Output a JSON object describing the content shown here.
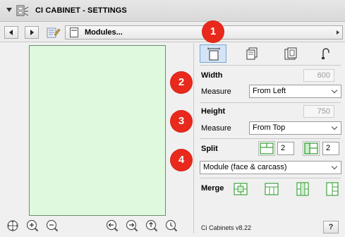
{
  "window": {
    "title": "CI CABINET - SETTINGS"
  },
  "toolbar": {
    "module_popup": "Modules..."
  },
  "width": {
    "title": "Width",
    "value": "600",
    "measure_label": "Measure",
    "measure_value": "From Left"
  },
  "height": {
    "title": "Height",
    "value": "750",
    "measure_label": "Measure",
    "measure_value": "From Top"
  },
  "split": {
    "title": "Split",
    "horizontal_count": "2",
    "vertical_count": "2",
    "mode_value": "Module (face & carcass)"
  },
  "merge": {
    "title": "Merge"
  },
  "footer": {
    "version": "Ci Cabinets v8.22",
    "help_label": "?"
  },
  "badges": [
    "1",
    "2",
    "3",
    "4"
  ],
  "colors": {
    "preview_fill": "#dff9df",
    "badge": "#e8291c",
    "active_tab": "#d4e4f6",
    "green_icon": "#3ea23e"
  },
  "icons": {
    "zoom_tools": [
      "zoom-fit-icon",
      "zoom-in-icon",
      "zoom-out-icon",
      "pan-left-icon",
      "pan-right-icon",
      "pan-up-icon",
      "rotate-icon"
    ],
    "tabs": [
      "width-tab-icon",
      "front-tab-icon",
      "module-tab-icon",
      "handle-tab-icon"
    ]
  }
}
